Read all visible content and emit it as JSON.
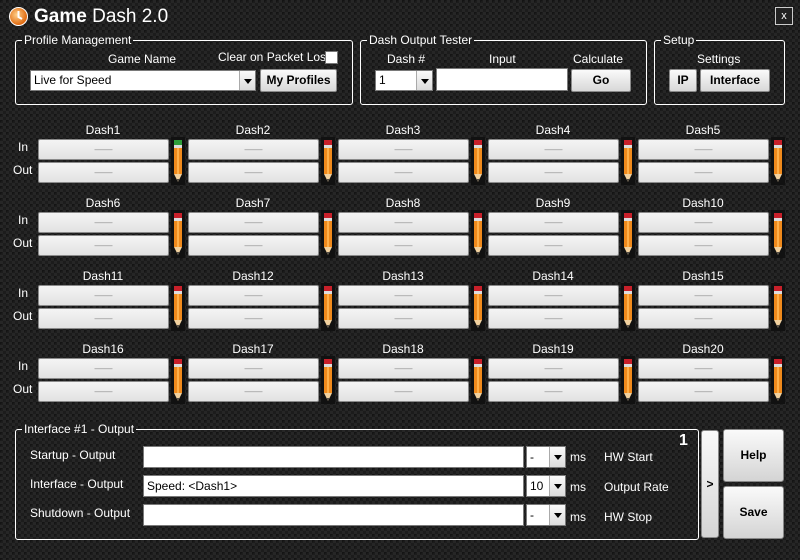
{
  "window": {
    "title_bold": "Game",
    "title_rest": " Dash 2.0",
    "close_label": "x"
  },
  "profile": {
    "legend": "Profile Management",
    "game_name_label": "Game Name",
    "game_value": "Live for Speed",
    "clear_label": "Clear on Packet Loss",
    "my_profiles_label": "My Profiles"
  },
  "tester": {
    "legend": "Dash Output Tester",
    "dash_label": "Dash #",
    "input_label": "Input",
    "calc_label": "Calculate",
    "dash_value": "1",
    "input_value": "",
    "go_label": "Go"
  },
  "setup": {
    "legend": "Setup",
    "settings_label": "Settings",
    "ip_label": "IP",
    "interface_label": "Interface"
  },
  "dash_grid": {
    "in_label": "In",
    "out_label": "Out",
    "placeholder": "——",
    "dashes": [
      {
        "name": "Dash1",
        "top_indicator": "green"
      },
      {
        "name": "Dash2",
        "top_indicator": "red"
      },
      {
        "name": "Dash3",
        "top_indicator": "red"
      },
      {
        "name": "Dash4",
        "top_indicator": "red"
      },
      {
        "name": "Dash5",
        "top_indicator": "red"
      },
      {
        "name": "Dash6",
        "top_indicator": "red"
      },
      {
        "name": "Dash7",
        "top_indicator": "red"
      },
      {
        "name": "Dash8",
        "top_indicator": "red"
      },
      {
        "name": "Dash9",
        "top_indicator": "red"
      },
      {
        "name": "Dash10",
        "top_indicator": "red"
      },
      {
        "name": "Dash11",
        "top_indicator": "red"
      },
      {
        "name": "Dash12",
        "top_indicator": "red"
      },
      {
        "name": "Dash13",
        "top_indicator": "red"
      },
      {
        "name": "Dash14",
        "top_indicator": "red"
      },
      {
        "name": "Dash15",
        "top_indicator": "red"
      },
      {
        "name": "Dash16",
        "top_indicator": "red"
      },
      {
        "name": "Dash17",
        "top_indicator": "red"
      },
      {
        "name": "Dash18",
        "top_indicator": "red"
      },
      {
        "name": "Dash19",
        "top_indicator": "red"
      },
      {
        "name": "Dash20",
        "top_indicator": "red"
      }
    ]
  },
  "interface": {
    "legend": "Interface #1 - Output",
    "number": "1",
    "startup_label": "Startup - Output",
    "startup_value": "",
    "startup_ms": "-",
    "hw_start_label": "HW Start",
    "interface_label": "Interface - Output",
    "interface_value": "Speed: <Dash1>",
    "interface_ms": "10",
    "output_rate_label": "Output Rate",
    "shutdown_label": "Shutdown - Output",
    "shutdown_value": "",
    "shutdown_ms": "-",
    "hw_stop_label": "HW Stop",
    "ms_label": "ms",
    "next_label": ">"
  },
  "actions": {
    "help_label": "Help",
    "save_label": "Save"
  },
  "colors": {
    "indicator_green": "#2e9e3a",
    "indicator_red": "#c8202a",
    "pencil_orange": "#f08a1c"
  }
}
